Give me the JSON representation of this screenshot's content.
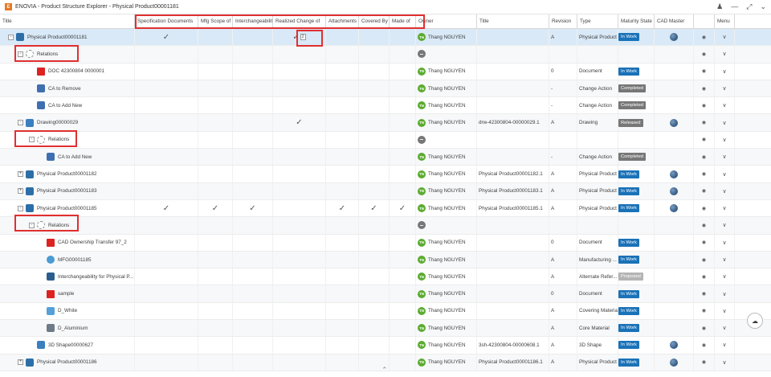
{
  "app": {
    "title": "ENOVIA - Product Structure Explorer - Physical Product00001181",
    "logo": "enovia-logo",
    "icons": [
      "share-icon",
      "minimize-icon",
      "expand-icon",
      "collapse-icon"
    ]
  },
  "headers": [
    "Title",
    "Specification Documents",
    "Mfg Scope of",
    "Interchangeability",
    "Realized Change of",
    "Attachments",
    "Covered By",
    "Made of",
    "Owner",
    "Title",
    "Revision",
    "Type",
    "Maturity State",
    "CAD Master",
    "",
    "Menu"
  ],
  "rows": [
    {
      "title": "Physical Product00001181",
      "indent": 0,
      "expand": "-",
      "icon": "prod",
      "checks": [
        1,
        0,
        0,
        1,
        0,
        0,
        0
      ],
      "checkcount": {
        "3": "2"
      },
      "owner": "Thang NGUYEN",
      "title2": "",
      "rev": "A",
      "type": "Physical Product",
      "state": "In Work",
      "stateClass": "work",
      "cad": true,
      "sel": true
    },
    {
      "title": "Relations",
      "indent": 1,
      "expand": "-",
      "icon": "rel",
      "checks": [
        0,
        0,
        0,
        0,
        0,
        0,
        0
      ],
      "owner": "",
      "ownerGrey": true,
      "title2": "",
      "rev": "",
      "type": "",
      "state": "",
      "cad": false
    },
    {
      "title": "DOC 42300804 0000001",
      "indent": 2,
      "expand": "",
      "icon": "doc",
      "checks": [
        0,
        0,
        0,
        0,
        0,
        0,
        0
      ],
      "owner": "Thang NGUYEN",
      "title2": "",
      "rev": "0",
      "type": "Document",
      "state": "In Work",
      "stateClass": "work",
      "cad": false
    },
    {
      "title": "CA to Remove",
      "indent": 2,
      "expand": "",
      "icon": "ca",
      "checks": [
        0,
        0,
        0,
        0,
        0,
        0,
        0
      ],
      "owner": "Thang NGUYEN",
      "title2": "",
      "rev": "-",
      "type": "Change Action",
      "state": "Completed",
      "stateClass": "comp",
      "cad": false
    },
    {
      "title": "CA to Add New",
      "indent": 2,
      "expand": "",
      "icon": "ca",
      "checks": [
        0,
        0,
        0,
        0,
        0,
        0,
        0
      ],
      "owner": "Thang NGUYEN",
      "title2": "",
      "rev": "-",
      "type": "Change Action",
      "state": "Completed",
      "stateClass": "comp",
      "cad": false
    },
    {
      "title": "Drawing00000029",
      "indent": 1,
      "expand": "-",
      "icon": "drw",
      "checks": [
        0,
        0,
        0,
        1,
        0,
        0,
        0
      ],
      "owner": "Thang NGUYEN",
      "title2": "drw-42300804-00000029.1",
      "rev": "A",
      "type": "Drawing",
      "state": "Released",
      "stateClass": "rel",
      "cad": true
    },
    {
      "title": "Relations",
      "indent": 2,
      "expand": "-",
      "icon": "rel",
      "checks": [
        0,
        0,
        0,
        0,
        0,
        0,
        0
      ],
      "owner": "",
      "ownerGrey": true,
      "title2": "",
      "rev": "",
      "type": "",
      "state": "",
      "cad": false
    },
    {
      "title": "CA to Add New",
      "indent": 3,
      "expand": "",
      "icon": "ca",
      "checks": [
        0,
        0,
        0,
        0,
        0,
        0,
        0
      ],
      "owner": "Thang NGUYEN",
      "title2": "",
      "rev": "-",
      "type": "Change Action",
      "state": "Completed",
      "stateClass": "comp",
      "cad": false
    },
    {
      "title": "Physical Product00001182",
      "indent": 1,
      "expand": "+",
      "icon": "prod",
      "checks": [
        0,
        0,
        0,
        0,
        0,
        0,
        0
      ],
      "owner": "Thang NGUYEN",
      "title2": "Physical Product00001182.1",
      "rev": "A",
      "type": "Physical Product",
      "state": "In Work",
      "stateClass": "work",
      "cad": true
    },
    {
      "title": "Physical Product00001183",
      "indent": 1,
      "expand": "+",
      "icon": "prod",
      "checks": [
        0,
        0,
        0,
        0,
        0,
        0,
        0
      ],
      "owner": "Thang NGUYEN",
      "title2": "Physical Product00001183.1",
      "rev": "A",
      "type": "Physical Product",
      "state": "In Work",
      "stateClass": "work",
      "cad": true
    },
    {
      "title": "Physical Product00001185",
      "indent": 1,
      "expand": "-",
      "icon": "prod",
      "checks": [
        1,
        1,
        1,
        0,
        1,
        1,
        1
      ],
      "owner": "Thang NGUYEN",
      "title2": "Physical Product00001185.1",
      "rev": "A",
      "type": "Physical Product",
      "state": "In Work",
      "stateClass": "work",
      "cad": true
    },
    {
      "title": "Relations",
      "indent": 2,
      "expand": "-",
      "icon": "rel",
      "checks": [
        0,
        0,
        0,
        0,
        0,
        0,
        0
      ],
      "owner": "",
      "ownerGrey": true,
      "title2": "",
      "rev": "",
      "type": "",
      "state": "",
      "cad": false
    },
    {
      "title": "CAD Ownership Transfer 97_2",
      "indent": 3,
      "expand": "",
      "icon": "doc",
      "checks": [
        0,
        0,
        0,
        0,
        0,
        0,
        0
      ],
      "owner": "Thang NGUYEN",
      "title2": "",
      "rev": "0",
      "type": "Document",
      "state": "In Work",
      "stateClass": "work",
      "cad": false
    },
    {
      "title": "MFG00001185",
      "indent": 3,
      "expand": "",
      "icon": "mfg",
      "checks": [
        0,
        0,
        0,
        0,
        0,
        0,
        0
      ],
      "owner": "Thang NGUYEN",
      "title2": "",
      "rev": "A",
      "type": "Manufacturing ...",
      "state": "In Work",
      "stateClass": "work",
      "cad": false
    },
    {
      "title": "Interchangeability for Physical P...",
      "indent": 3,
      "expand": "",
      "icon": "alt",
      "checks": [
        0,
        0,
        0,
        0,
        0,
        0,
        0
      ],
      "owner": "Thang NGUYEN",
      "title2": "",
      "rev": "A",
      "type": "Alternate Refer...",
      "state": "Proposed",
      "stateClass": "prop",
      "cad": false
    },
    {
      "title": "sample",
      "indent": 3,
      "expand": "",
      "icon": "doc",
      "checks": [
        0,
        0,
        0,
        0,
        0,
        0,
        0
      ],
      "owner": "Thang NGUYEN",
      "title2": "",
      "rev": "0",
      "type": "Document",
      "state": "In Work",
      "stateClass": "work",
      "cad": false
    },
    {
      "title": "D_White",
      "indent": 3,
      "expand": "",
      "icon": "cov",
      "checks": [
        0,
        0,
        0,
        0,
        0,
        0,
        0
      ],
      "owner": "Thang NGUYEN",
      "title2": "",
      "rev": "A",
      "type": "Covering Material",
      "state": "In Work",
      "stateClass": "work",
      "cad": false
    },
    {
      "title": "D_Aluminium",
      "indent": 3,
      "expand": "",
      "icon": "core",
      "checks": [
        0,
        0,
        0,
        0,
        0,
        0,
        0
      ],
      "owner": "Thang NGUYEN",
      "title2": "",
      "rev": "A",
      "type": "Core Material",
      "state": "In Work",
      "stateClass": "work",
      "cad": false
    },
    {
      "title": "3D Shape00000627",
      "indent": 2,
      "expand": "",
      "icon": "drw",
      "checks": [
        0,
        0,
        0,
        0,
        0,
        0,
        0
      ],
      "owner": "Thang NGUYEN",
      "title2": "3sh-42300804-00000608.1",
      "rev": "A",
      "type": "3D Shape",
      "state": "In Work",
      "stateClass": "work",
      "cad": true
    },
    {
      "title": "Physical Product00001186",
      "indent": 1,
      "expand": "+",
      "icon": "prod",
      "checks": [
        0,
        0,
        0,
        0,
        0,
        0,
        0
      ],
      "owner": "Thang NGUYEN",
      "title2": "Physical Product00001186.1",
      "rev": "A",
      "type": "Physical Product",
      "state": "In Work",
      "stateClass": "work",
      "cad": true
    }
  ]
}
